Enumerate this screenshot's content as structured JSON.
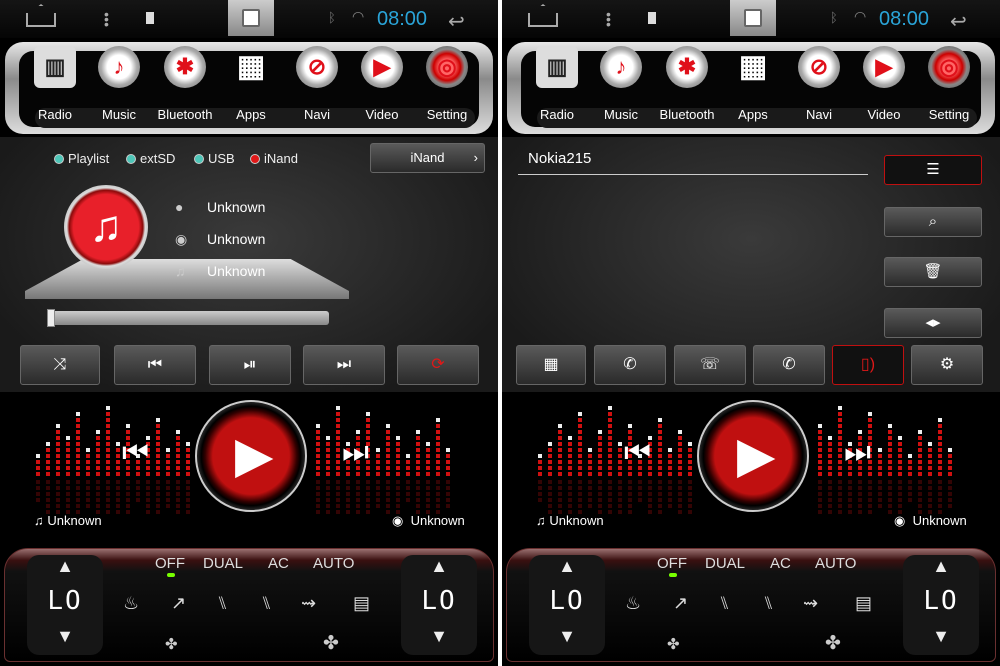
{
  "status": {
    "time": "08:00"
  },
  "nav": [
    {
      "label": "Radio",
      "icon": "radio-icon"
    },
    {
      "label": "Music",
      "icon": "music-note-icon"
    },
    {
      "label": "Bluetooth",
      "icon": "bluetooth-icon"
    },
    {
      "label": "Apps",
      "icon": "apps-grid-icon"
    },
    {
      "label": "Navi",
      "icon": "compass-icon"
    },
    {
      "label": "Video",
      "icon": "video-play-icon"
    },
    {
      "label": "Setting",
      "icon": "gear-icon"
    }
  ],
  "music": {
    "sources": [
      {
        "label": "Playlist",
        "selected": false
      },
      {
        "label": "extSD",
        "selected": false
      },
      {
        "label": "USB",
        "selected": false
      },
      {
        "label": "iNand",
        "selected": true
      }
    ],
    "source_button": "iNand",
    "artist": "Unknown",
    "album": "Unknown",
    "title": "Unknown",
    "progress": 0,
    "controls": [
      "shuffle-icon",
      "previous-icon",
      "play-pause-icon",
      "next-icon",
      "repeat-icon"
    ]
  },
  "bluetooth": {
    "device_name": "Nokia215",
    "side_buttons": [
      "list-icon",
      "search-icon",
      "delete-icon",
      "transfer-icon"
    ],
    "bottom_buttons": [
      "dialpad-icon",
      "call-log-icon",
      "contacts-icon",
      "phone-call-icon",
      "phone-audio-icon",
      "settings-icon"
    ],
    "active_bottom": "phone-audio-icon"
  },
  "visualizer": {
    "left_label": "Unknown",
    "right_label": "Unknown"
  },
  "climate": {
    "modes": [
      "OFF",
      "DUAL",
      "AC",
      "AUTO"
    ],
    "active_mode": "OFF",
    "left_temp": "LO",
    "right_temp": "LO"
  },
  "colors": {
    "accent": "#e01818",
    "clock": "#2aa4d8",
    "led": "#77ff00"
  }
}
